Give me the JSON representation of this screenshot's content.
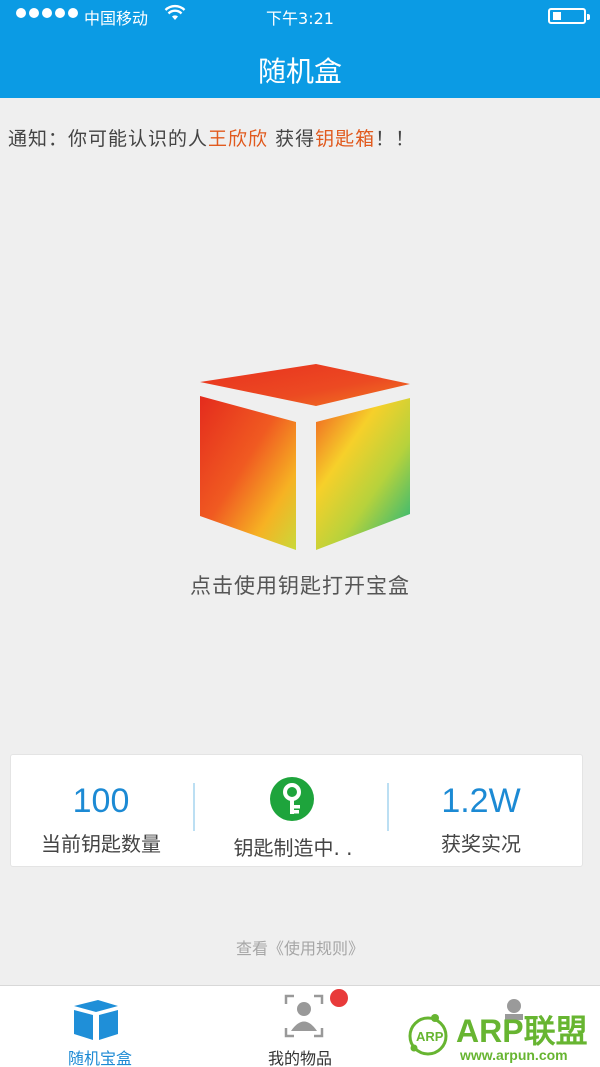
{
  "status_bar": {
    "carrier": "中国移动",
    "time": "下午3:21"
  },
  "nav": {
    "title": "随机盒"
  },
  "notice": {
    "prefix": "通知：你可能认识的人",
    "person": "王欣欣",
    "middle": " 获得",
    "item": "钥匙箱",
    "suffix": "！！",
    "highlight_color": "#e15a1e"
  },
  "box": {
    "hint": "点击使用钥匙打开宝盒"
  },
  "stats": {
    "key_count": {
      "value": "100",
      "label": "当前钥匙数量"
    },
    "key_making": {
      "label": "钥匙制造中. ."
    },
    "prizes": {
      "value": "1.2W",
      "label": "获奖实况"
    }
  },
  "rules_link": "查看《使用规则》",
  "tabs": [
    {
      "label": "随机宝盒",
      "active": true,
      "icon": "cube-icon"
    },
    {
      "label": "我的物品",
      "active": false,
      "icon": "user-scan-icon",
      "has_badge": true
    },
    {
      "label": "",
      "active": false,
      "icon": "profile-icon"
    }
  ],
  "watermark": {
    "logo_text": "ARP",
    "brand": "ARP联盟",
    "url": "www.arpun.com"
  },
  "colors": {
    "header": "#0b9be4",
    "accent": "#1c8ad4",
    "key_green": "#1ea43c",
    "badge": "#e83a3a"
  }
}
